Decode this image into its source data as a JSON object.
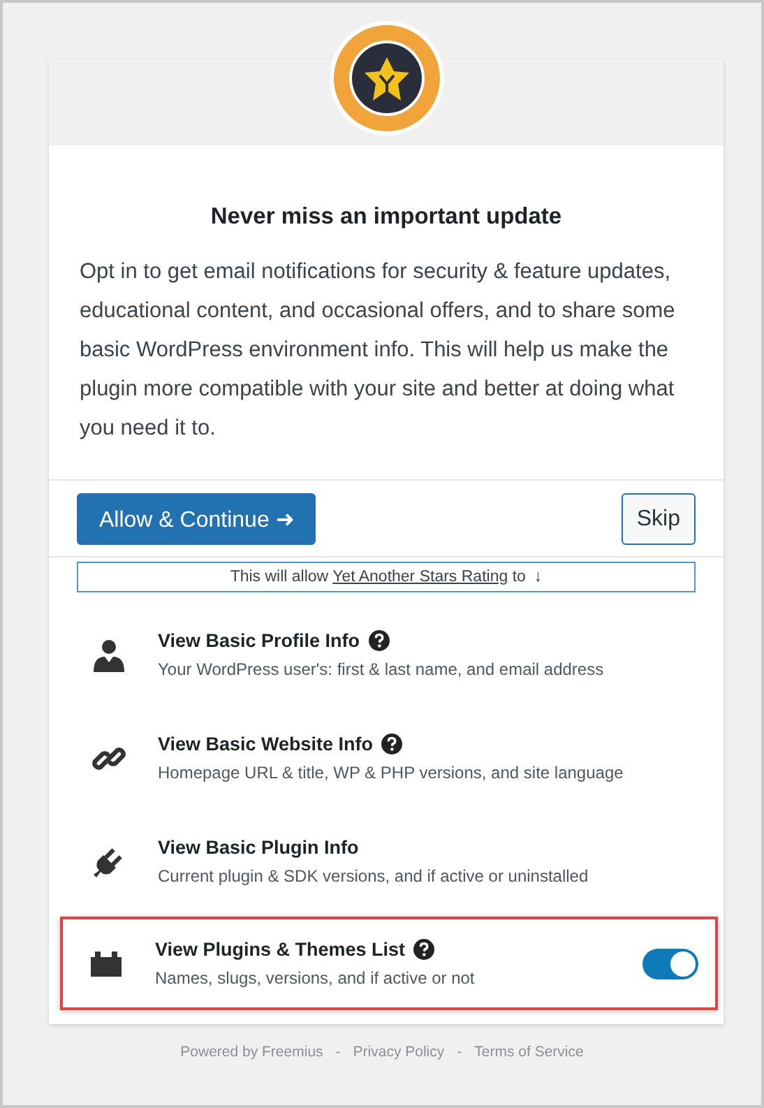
{
  "header": {
    "title": "Never miss an important update",
    "body": "Opt in to get email notifications for security & feature updates, educational content, and occasional offers, and to share some basic WordPress environment info. This will help us make the plugin more compatible with your site and better at doing what you need it to."
  },
  "actions": {
    "primary": "Allow & Continue ➜",
    "skip": "Skip"
  },
  "notice": {
    "before": "This will allow ",
    "link": "Yet Another Stars Rating",
    "after": " to",
    "arrow": "↓"
  },
  "permissions": [
    {
      "kind": "person",
      "title": "View Basic Profile Info",
      "help": true,
      "description": "Your WordPress user's: first & last name, and email address",
      "highlighted": false
    },
    {
      "kind": "link",
      "title": "View Basic Website Info",
      "help": true,
      "description": "Homepage URL & title, WP & PHP versions, and site language",
      "highlighted": false
    },
    {
      "kind": "plug",
      "title": "View Basic Plugin Info",
      "help": false,
      "description": "Current plugin & SDK versions, and if active or uninstalled",
      "highlighted": false
    },
    {
      "kind": "blocks",
      "title": "View Plugins & Themes List",
      "help": true,
      "description": "Names, slugs, versions, and if active or not",
      "highlighted": true,
      "toggle": {
        "on": true
      }
    }
  ],
  "footer": [
    {
      "text": "Powered by Freemius"
    },
    {
      "text": "Privacy Policy"
    },
    {
      "text": "Terms of Service"
    }
  ],
  "footer_separator": "-"
}
